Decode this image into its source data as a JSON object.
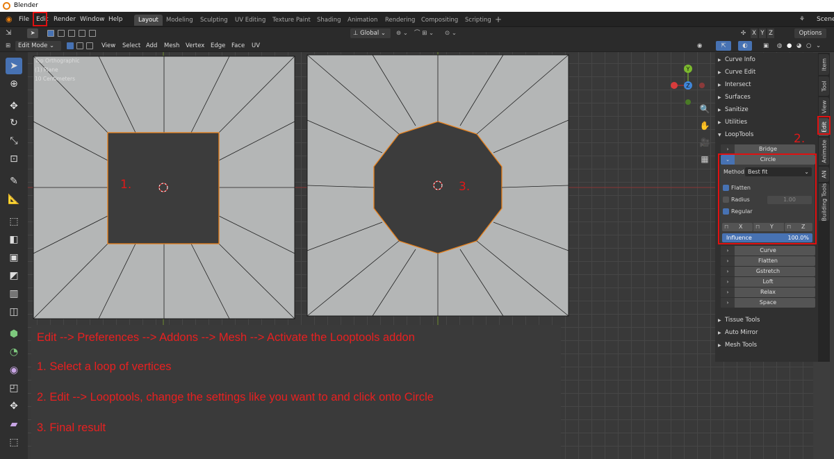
{
  "window": {
    "title": "Blender"
  },
  "menu": [
    "File",
    "Edit",
    "Render",
    "Window",
    "Help"
  ],
  "workspaces": [
    "Layout",
    "Modeling",
    "Sculpting",
    "UV Editing",
    "Texture Paint",
    "Shading",
    "Animation",
    "Rendering",
    "Compositing",
    "Scripting"
  ],
  "active_workspace": "Layout",
  "scene_label": "Scene",
  "header2": {
    "orientation": "Global",
    "xyz": [
      "X",
      "Y",
      "Z"
    ],
    "options": "Options"
  },
  "header3": {
    "mode": "Edit Mode",
    "menus": [
      "View",
      "Select",
      "Add",
      "Mesh",
      "Vertex",
      "Edge",
      "Face",
      "UV"
    ]
  },
  "viewport": {
    "view_name": "Top Orthographic",
    "object": "(1) Plane",
    "scale": "10 Centimeters"
  },
  "gizmo": {
    "y": "Y",
    "z": "Z"
  },
  "sidebar": {
    "sections": [
      "Curve Info",
      "Curve Edit",
      "Intersect",
      "Surfaces",
      "Sanitize",
      "Utilities",
      "LoopTools"
    ],
    "looptools_top": [
      "Bridge",
      "Circle"
    ],
    "circle": {
      "method_label": "Method:",
      "method_value": "Best fit",
      "flatten": "Flatten",
      "radius": "Radius",
      "radius_value": "1.00",
      "regular": "Regular",
      "axes": [
        "X",
        "Y",
        "Z"
      ],
      "influence_label": "Influence",
      "influence_value": "100.0%"
    },
    "looptools_rest": [
      "Curve",
      "Flatten",
      "Gstretch",
      "Loft",
      "Relax",
      "Space"
    ],
    "after": [
      "Tissue Tools",
      "Auto Mirror",
      "Mesh Tools"
    ]
  },
  "tabs": [
    "Item",
    "Tool",
    "View",
    "Edit",
    "Animate",
    "AN",
    "Building Tools"
  ],
  "active_tab": "Edit",
  "annotations": {
    "step1": "1.",
    "step2": "2.",
    "step3": "3."
  },
  "instructions": [
    "Edit --> Preferences --> Addons --> Mesh --> Activate the Looptools addon",
    "1. Select a loop of vertices",
    "2. Edit --> Looptools,  change the settings like you want to and click onto Circle",
    "3. Final result"
  ],
  "colors": {
    "accent": "#4772b3",
    "annotation_red": "#e01818",
    "mesh_face": "#b4b6b6",
    "selected_edge": "#e8801a"
  }
}
